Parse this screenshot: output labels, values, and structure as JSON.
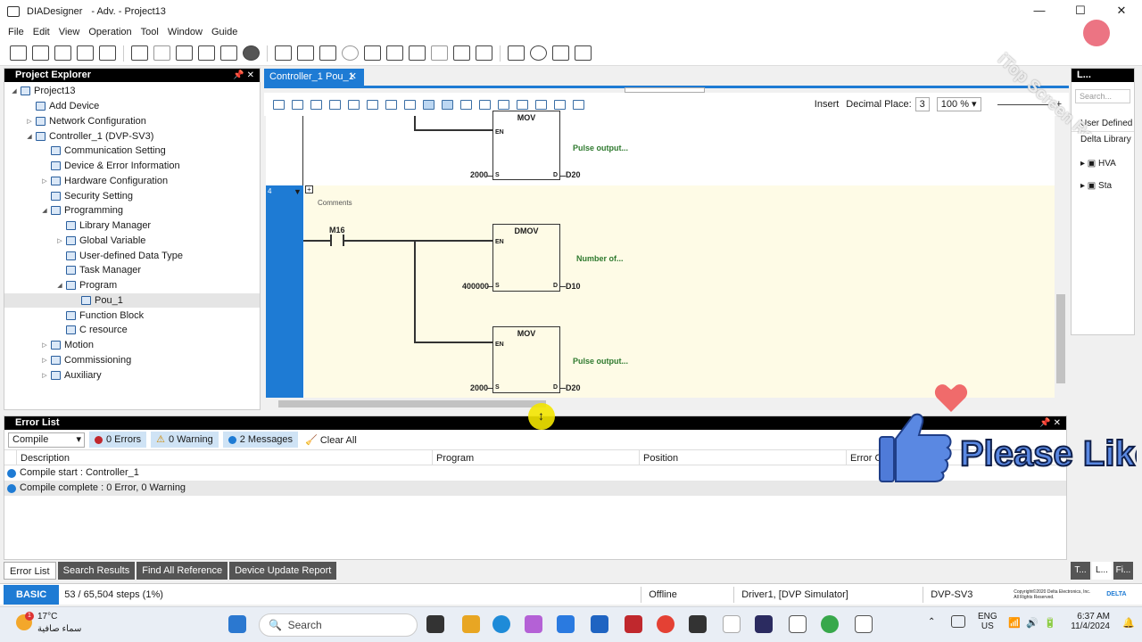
{
  "window": {
    "app": "DIADesigner",
    "mode": "- Adv. - Project13",
    "controls": [
      "—",
      "☐",
      "✕"
    ]
  },
  "menu": [
    "File",
    "Edit",
    "View",
    "Operation",
    "Tool",
    "Window",
    "Guide"
  ],
  "project_explorer": {
    "title": "Project Explorer",
    "items": [
      {
        "label": "Project13",
        "depth": 0,
        "arrow": "◢"
      },
      {
        "label": "Add Device",
        "depth": 1,
        "arrow": ""
      },
      {
        "label": "Network Configuration",
        "depth": 1,
        "arrow": "▷"
      },
      {
        "label": "Controller_1 (DVP-SV3)",
        "depth": 1,
        "arrow": "◢"
      },
      {
        "label": "Communication Setting",
        "depth": 2,
        "arrow": ""
      },
      {
        "label": "Device & Error Information",
        "depth": 2,
        "arrow": ""
      },
      {
        "label": "Hardware Configuration",
        "depth": 2,
        "arrow": "▷"
      },
      {
        "label": "Security Setting",
        "depth": 2,
        "arrow": ""
      },
      {
        "label": "Programming",
        "depth": 2,
        "arrow": "◢"
      },
      {
        "label": "Library Manager",
        "depth": 3,
        "arrow": ""
      },
      {
        "label": "Global Variable",
        "depth": 3,
        "arrow": "▷"
      },
      {
        "label": "User-defined Data Type",
        "depth": 3,
        "arrow": ""
      },
      {
        "label": "Task Manager",
        "depth": 3,
        "arrow": ""
      },
      {
        "label": "Program",
        "depth": 3,
        "arrow": "◢"
      },
      {
        "label": "Pou_1",
        "depth": 4,
        "arrow": "",
        "selected": true
      },
      {
        "label": "Function Block",
        "depth": 3,
        "arrow": ""
      },
      {
        "label": "C resource",
        "depth": 3,
        "arrow": ""
      },
      {
        "label": "Motion",
        "depth": 2,
        "arrow": "▷"
      },
      {
        "label": "Commissioning",
        "depth": 2,
        "arrow": "▷"
      },
      {
        "label": "Auxiliary",
        "depth": 2,
        "arrow": "▷"
      }
    ]
  },
  "editor": {
    "tab": "Controller_1 Pou_1",
    "insert": "Insert",
    "decimal_label": "Decimal Place:",
    "decimal_value": "3",
    "zoom": "100 %",
    "rung_number": "4",
    "comment": "Comments",
    "blocks": {
      "top_mov": {
        "name": "MOV",
        "en": "EN",
        "s": "S",
        "d": "D",
        "in": "2000",
        "out": "D20",
        "comment": "Pulse output..."
      },
      "dmov": {
        "name": "DMOV",
        "en": "EN",
        "s": "S",
        "d": "D",
        "in": "400000",
        "out": "D10",
        "comment": "Number of..."
      },
      "mov2": {
        "name": "MOV",
        "en": "EN",
        "s": "S",
        "d": "D",
        "in": "2000",
        "out": "D20",
        "comment": "Pulse output..."
      }
    },
    "contact": "M16"
  },
  "right_panel": {
    "title": "L...",
    "search_placeholder": "Search...",
    "items": [
      "User Defined",
      "Delta Library",
      "HVA",
      "Sta"
    ]
  },
  "error_list": {
    "title": "Error List",
    "mode": "Compile",
    "errors": "0 Errors",
    "warnings": "0 Warning",
    "messages": "2 Messages",
    "clear": "Clear All",
    "columns": [
      "Description",
      "Program",
      "Position",
      "Error C"
    ],
    "rows": [
      "Compile start : Controller_1",
      "Compile complete : 0 Error, 0 Warning"
    ]
  },
  "bottom_tabs": [
    "Error List",
    "Search Results",
    "Find All Reference",
    "Device Update Report"
  ],
  "right_bottom_tabs": [
    "T...",
    "L...",
    "Fi..."
  ],
  "status": {
    "mode": "BASIC",
    "steps": "53 / 65,504 steps (1%)",
    "online": "Offline",
    "driver": "Driver1, [DVP Simulator]",
    "model": "DVP-SV3",
    "copyright1": "Copyright©2020 Delta Electronics, Inc.",
    "copyright2": "All Rights Reserved.",
    "brand": "DELTA"
  },
  "taskbar": {
    "temp": "17°C",
    "weather": "سماء صافية",
    "badge": "1",
    "search": "Search",
    "lang1": "ENG",
    "lang2": "US",
    "time": "6:37 AM",
    "date": "11/4/2024"
  },
  "overlay": {
    "like": "Please Like",
    "watermark": "iTop Screen Recorder"
  }
}
